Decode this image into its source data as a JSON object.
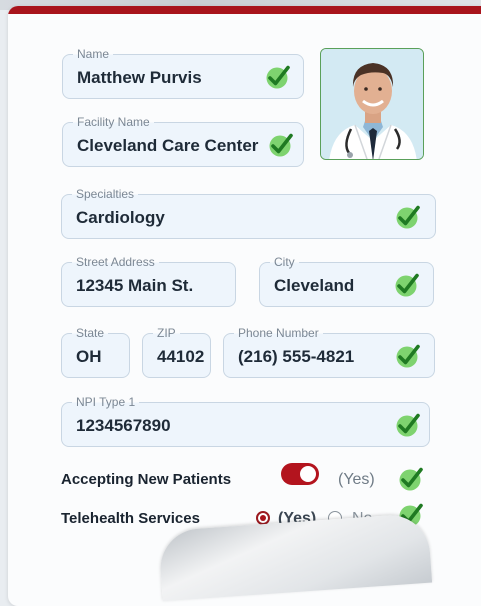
{
  "form": {
    "name": {
      "label": "Name",
      "value": "Matthew Purvis"
    },
    "facility": {
      "label": "Facility Name",
      "value": "Cleveland Care Center"
    },
    "specialties": {
      "label": "Specialties",
      "value": "Cardiology"
    },
    "street": {
      "label": "Street Address",
      "value": "12345 Main St."
    },
    "city": {
      "label": "City",
      "value": "Cleveland"
    },
    "state": {
      "label": "State",
      "value": "OH"
    },
    "zip": {
      "label": "ZIP",
      "value": "44102"
    },
    "phone": {
      "label": "Phone Number",
      "value": "(216) 555-4821"
    },
    "npi": {
      "label": "NPI Type 1",
      "value": "1234567890"
    }
  },
  "toggles": {
    "accepting": {
      "label": "Accepting New Patients",
      "state_text": "(Yes)",
      "on": true
    },
    "telehealth": {
      "label": "Telehealth Services",
      "yes_text": "(Yes)",
      "no_text": "No",
      "selected": "yes"
    }
  },
  "icons": {
    "check": "check-icon",
    "avatar": "doctor-avatar"
  },
  "colors": {
    "accent": "#a8141c",
    "check_green": "#2e9a2e",
    "check_fill": "#7ed36f",
    "field_bg": "#eef5fc"
  }
}
